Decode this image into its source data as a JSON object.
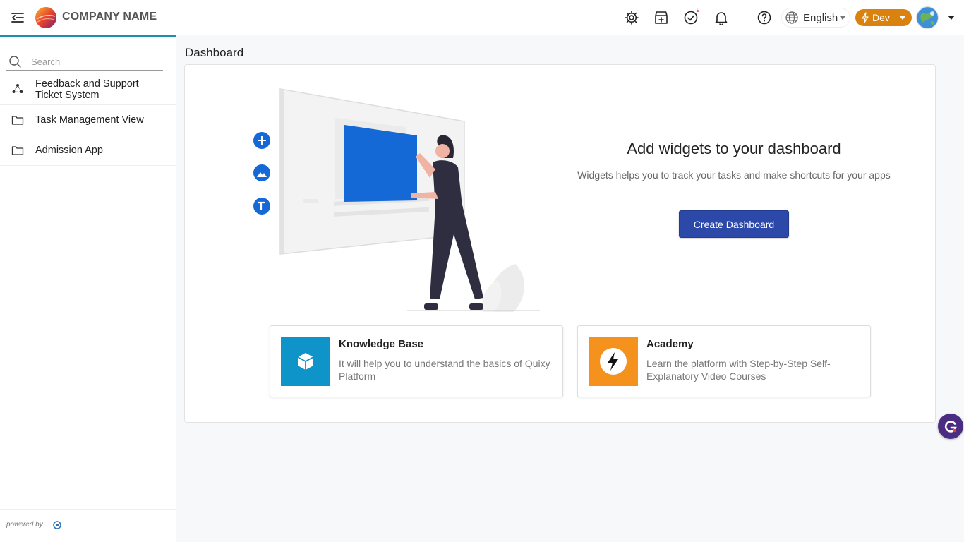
{
  "header": {
    "brand": "COMPANY NAME",
    "icons": [
      "menu-collapse-icon",
      "settings-icon",
      "store-icon",
      "tasks-check-icon",
      "bell-icon",
      "help-icon",
      "globe-icon"
    ],
    "tasks_badge": "9",
    "language": "English",
    "environment": "Dev",
    "accent_color": "#d9820f"
  },
  "sidebar": {
    "search_placeholder": "Search",
    "items": [
      {
        "label_line1": "Feedback and Support",
        "label_line2": "Ticket System",
        "icon": "app-triangle-icon"
      },
      {
        "label": "Task Management View",
        "icon": "folder-icon"
      },
      {
        "label": "Admission App",
        "icon": "folder-icon"
      }
    ],
    "powered_by": "powered by",
    "accent_color": "#1a8fb0"
  },
  "main": {
    "page_title": "Dashboard",
    "empty_state": {
      "title": "Add widgets to your dashboard",
      "subtitle": "Widgets helps you to track your tasks and make shortcuts for your apps",
      "button": "Create Dashboard",
      "button_color": "#2c48a8"
    },
    "tiles": [
      {
        "title": "Knowledge Base",
        "description": "It will help you to understand the basics of Quixy Platform",
        "icon": "cube-icon",
        "color": "#0f94c9"
      },
      {
        "title": "Academy",
        "description": "Learn the platform with Step-by-Step Self-Explanatory Video Courses",
        "icon": "lightning-icon",
        "color": "#f5921e"
      }
    ]
  }
}
